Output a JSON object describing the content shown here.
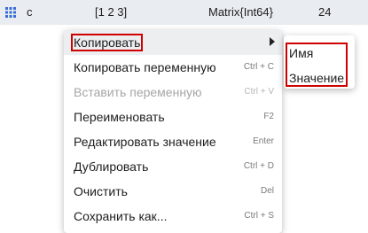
{
  "variable_row": {
    "icon": "grid-icon",
    "name": "c",
    "value": "[1 2 3]",
    "type": "Matrix{Int64}",
    "size": "24"
  },
  "context_menu": {
    "items": [
      {
        "label": "Копировать",
        "shortcut": "",
        "has_submenu": true,
        "disabled": false
      },
      {
        "label": "Копировать переменную",
        "shortcut": "Ctrl + C",
        "disabled": false
      },
      {
        "label": "Вставить переменную",
        "shortcut": "Ctrl + V",
        "disabled": true
      },
      {
        "label": "Переименовать",
        "shortcut": "F2",
        "disabled": false
      },
      {
        "label": "Редактировать значение",
        "shortcut": "Enter",
        "disabled": false
      },
      {
        "label": "Дублировать",
        "shortcut": "Ctrl + D",
        "disabled": false
      },
      {
        "label": "Очистить",
        "shortcut": "Del",
        "disabled": false
      },
      {
        "label": "Сохранить как...",
        "shortcut": "Ctrl + S",
        "disabled": false
      }
    ]
  },
  "submenu": {
    "items": [
      {
        "label": "Имя"
      },
      {
        "label": "Значение"
      }
    ]
  },
  "colors": {
    "highlight_outline": "#d00000",
    "row_background": "#e9ecf0",
    "grid_icon": "#3b6fd8"
  }
}
